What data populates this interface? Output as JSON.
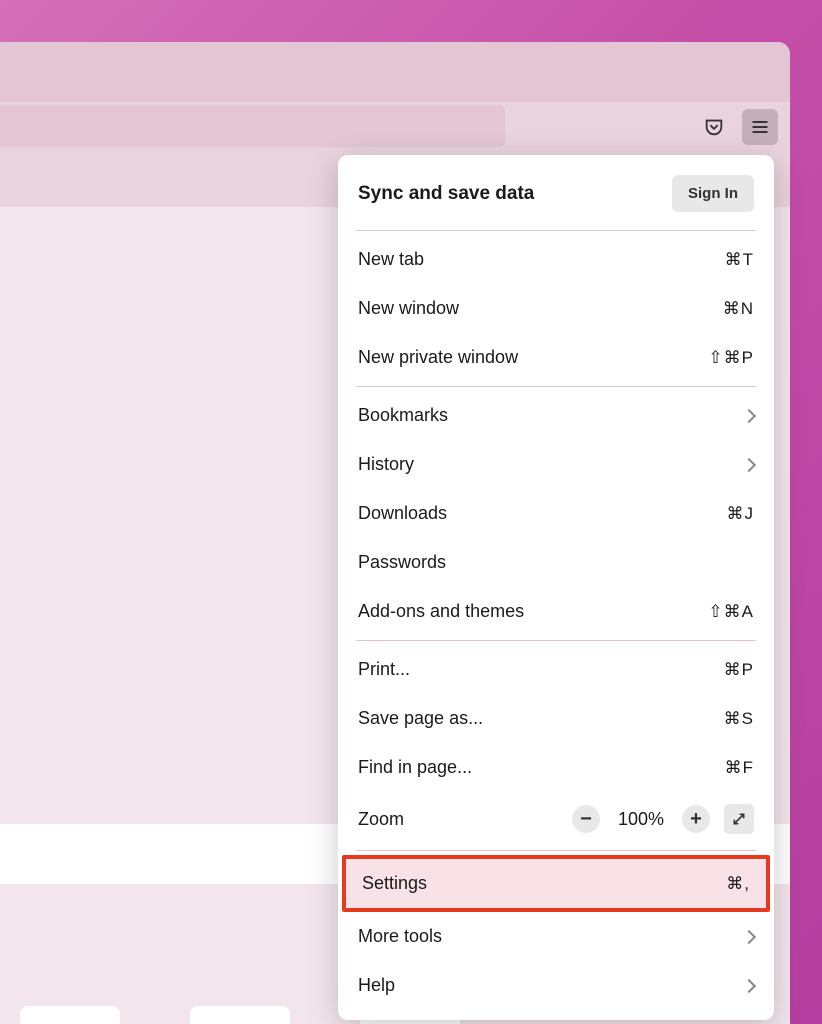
{
  "menu": {
    "header": {
      "title": "Sync and save data",
      "sign_in": "Sign In"
    },
    "section1": [
      {
        "label": "New tab",
        "shortcut": "⌘T"
      },
      {
        "label": "New window",
        "shortcut": "⌘N"
      },
      {
        "label": "New private window",
        "shortcut": "⇧⌘P"
      }
    ],
    "section2": [
      {
        "label": "Bookmarks",
        "chevron": true
      },
      {
        "label": "History",
        "chevron": true
      },
      {
        "label": "Downloads",
        "shortcut": "⌘J"
      },
      {
        "label": "Passwords"
      },
      {
        "label": "Add-ons and themes",
        "shortcut": "⇧⌘A"
      }
    ],
    "section3": [
      {
        "label": "Print...",
        "shortcut": "⌘P"
      },
      {
        "label": "Save page as...",
        "shortcut": "⌘S"
      },
      {
        "label": "Find in page...",
        "shortcut": "⌘F"
      }
    ],
    "zoom": {
      "label": "Zoom",
      "value": "100%",
      "minus": "−",
      "plus": "+"
    },
    "settings": {
      "label": "Settings",
      "shortcut": "⌘,"
    },
    "section4": [
      {
        "label": "More tools",
        "chevron": true
      },
      {
        "label": "Help",
        "chevron": true
      }
    ]
  }
}
